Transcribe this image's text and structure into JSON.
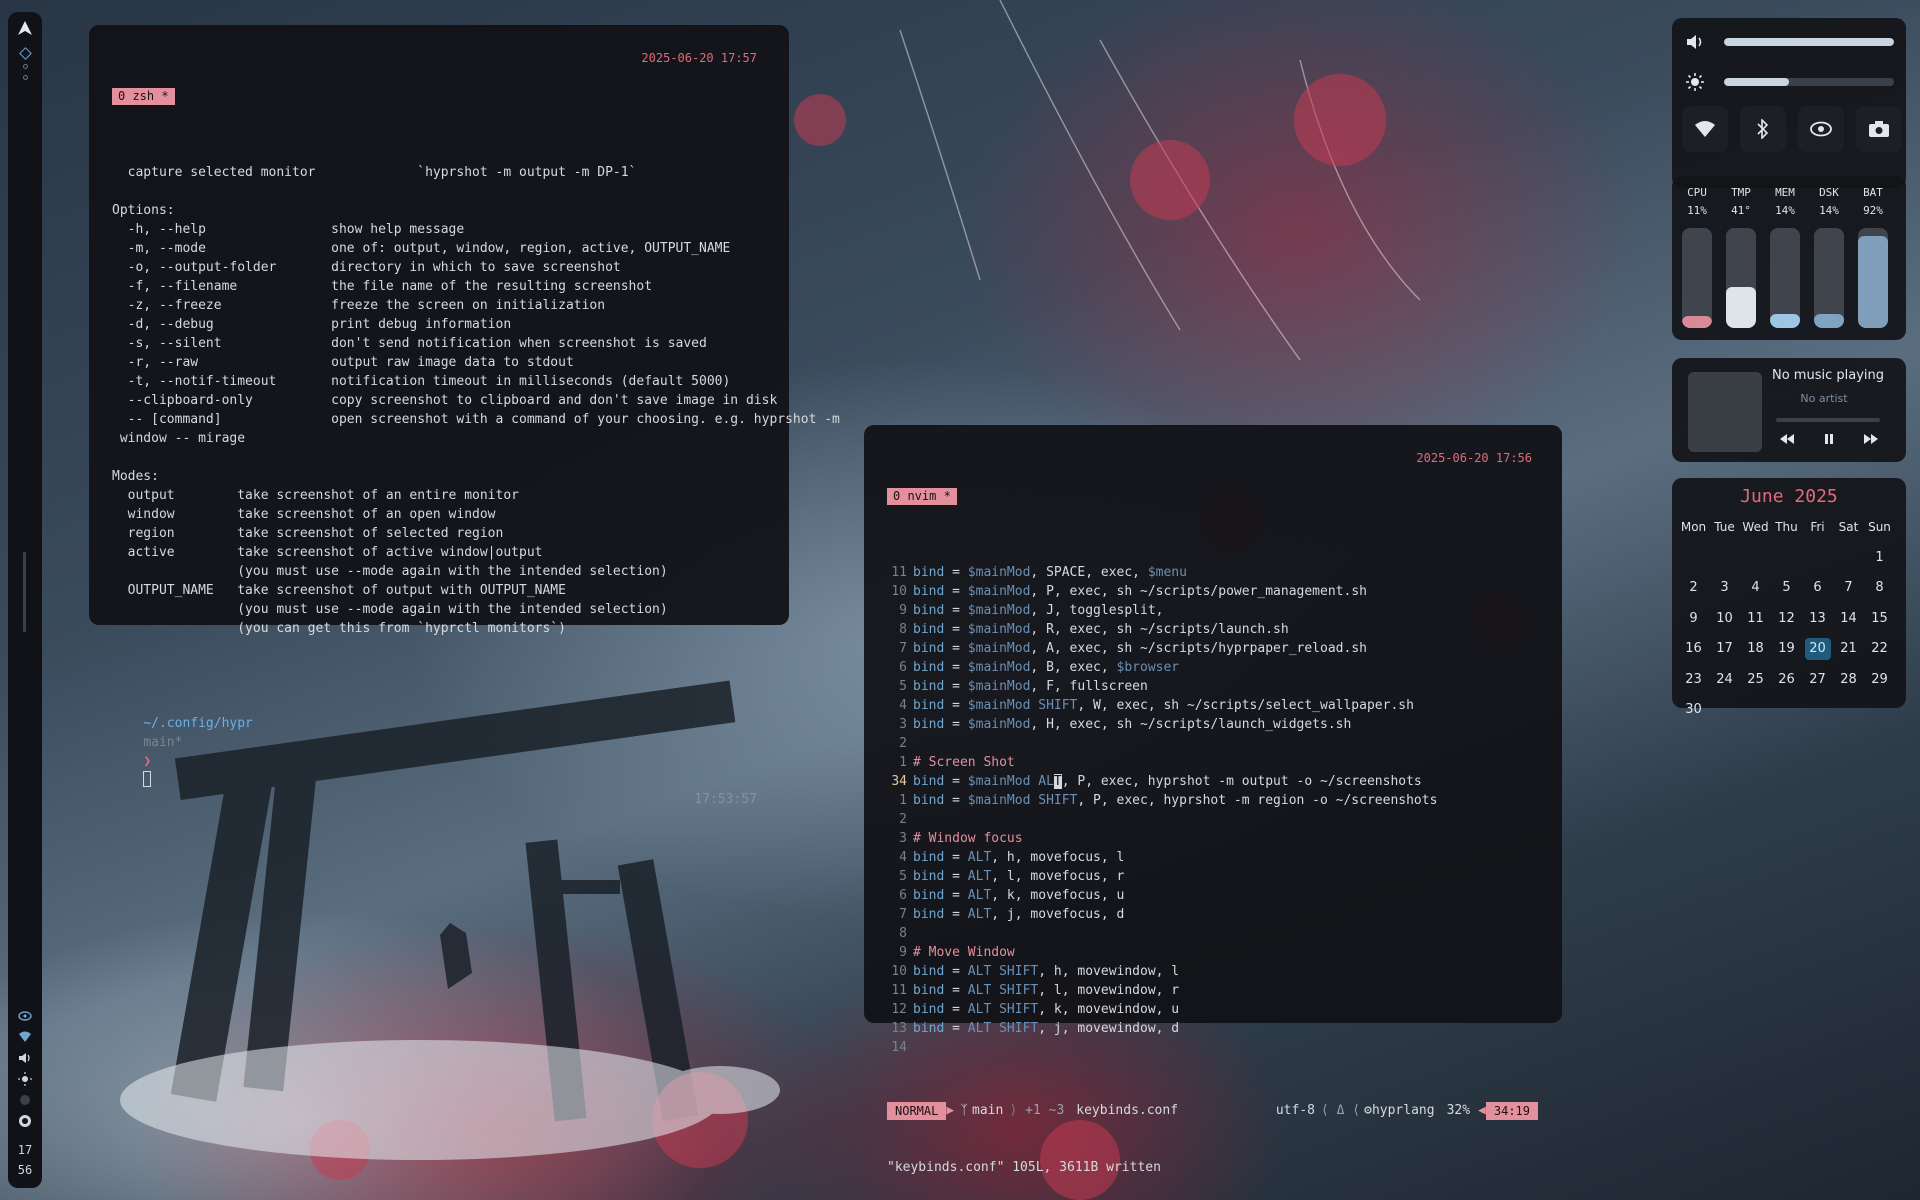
{
  "sidebar": {
    "logo": "arch-logo",
    "clock_hour": "17",
    "clock_min": "56"
  },
  "term1": {
    "tab": "0 zsh *",
    "timestamp": "2025-06-20 17:57",
    "lines": [
      "  capture selected monitor             `hyprshot -m output -m DP-1`",
      "",
      "Options:",
      "  -h, --help                show help message",
      "  -m, --mode                one of: output, window, region, active, OUTPUT_NAME",
      "  -o, --output-folder       directory in which to save screenshot",
      "  -f, --filename            the file name of the resulting screenshot",
      "  -z, --freeze              freeze the screen on initialization",
      "  -d, --debug               print debug information",
      "  -s, --silent              don't send notification when screenshot is saved",
      "  -r, --raw                 output raw image data to stdout",
      "  -t, --notif-timeout       notification timeout in milliseconds (default 5000)",
      "  --clipboard-only          copy screenshot to clipboard and don't save image in disk",
      "  -- [command]              open screenshot with a command of your choosing. e.g. hyprshot -m",
      " window -- mirage",
      "",
      "Modes:",
      "  output        take screenshot of an entire monitor",
      "  window        take screenshot of an open window",
      "  region        take screenshot of selected region",
      "  active        take screenshot of active window|output",
      "                (you must use --mode again with the intended selection)",
      "  OUTPUT_NAME   take screenshot of output with OUTPUT_NAME",
      "                (you must use --mode again with the intended selection)",
      "                (you can get this from `hyprctl monitors`)",
      ""
    ],
    "prompt_path": "~/.config/hypr",
    "prompt_branch": "main*",
    "prompt_arrow": "❯",
    "prompt_time": "17:53:57"
  },
  "term2": {
    "tab": "0 nvim *",
    "timestamp": "2025-06-20 17:56",
    "code": [
      {
        "n": "11",
        "k": "bind",
        "rest": " = ",
        "v": "$mainMod",
        "tail": ", SPACE, exec, ",
        "v2": "$menu"
      },
      {
        "n": "10",
        "k": "bind",
        "rest": " = ",
        "v": "$mainMod",
        "tail": ", P, exec, sh ~/scripts/power_management.sh"
      },
      {
        "n": "9",
        "k": "bind",
        "rest": " = ",
        "v": "$mainMod",
        "tail": ", J, togglesplit,"
      },
      {
        "n": "8",
        "k": "bind",
        "rest": " = ",
        "v": "$mainMod",
        "tail": ", R, exec, sh ~/scripts/launch.sh"
      },
      {
        "n": "7",
        "k": "bind",
        "rest": " = ",
        "v": "$mainMod",
        "tail": ", A, exec, sh ~/scripts/hyprpaper_reload.sh"
      },
      {
        "n": "6",
        "k": "bind",
        "rest": " = ",
        "v": "$mainMod",
        "tail": ", B, exec, ",
        "v2": "$browser"
      },
      {
        "n": "5",
        "k": "bind",
        "rest": " = ",
        "v": "$mainMod",
        "tail": ", F, fullscreen"
      },
      {
        "n": "4",
        "k": "bind",
        "rest": " = ",
        "v": "$mainMod SHIFT",
        "tail": ", W, exec, sh ~/scripts/select_wallpaper.sh"
      },
      {
        "n": "3",
        "k": "bind",
        "rest": " = ",
        "v": "$mainMod",
        "tail": ", H, exec, sh ~/scripts/launch_widgets.sh"
      },
      {
        "n": "2"
      },
      {
        "n": "1",
        "c": "# Screen Shot"
      },
      {
        "n": "34",
        "cur": true,
        "k": "bind",
        "rest": " = ",
        "v": "$mainMod AL",
        "curch": "T",
        "tail": ", P, exec, hyprshot -m output -o ~/screenshots"
      },
      {
        "n": "1",
        "k": "bind",
        "rest": " = ",
        "v": "$mainMod SHIFT",
        "tail": ", P, exec, hyprshot -m region -o ~/screenshots"
      },
      {
        "n": "2"
      },
      {
        "n": "3",
        "c": "# Window focus"
      },
      {
        "n": "4",
        "k": "bind",
        "rest": " = ",
        "v": "ALT",
        "tail": ", h, movefocus, l"
      },
      {
        "n": "5",
        "k": "bind",
        "rest": " = ",
        "v": "ALT",
        "tail": ", l, movefocus, r"
      },
      {
        "n": "6",
        "k": "bind",
        "rest": " = ",
        "v": "ALT",
        "tail": ", k, movefocus, u"
      },
      {
        "n": "7",
        "k": "bind",
        "rest": " = ",
        "v": "ALT",
        "tail": ", j, movefocus, d"
      },
      {
        "n": "8"
      },
      {
        "n": "9",
        "c": "# Move Window"
      },
      {
        "n": "10",
        "k": "bind",
        "rest": " = ",
        "v": "ALT SHIFT",
        "tail": ", h, movewindow, l"
      },
      {
        "n": "11",
        "k": "bind",
        "rest": " = ",
        "v": "ALT SHIFT",
        "tail": ", l, movewindow, r"
      },
      {
        "n": "12",
        "k": "bind",
        "rest": " = ",
        "v": "ALT SHIFT",
        "tail": ", k, movewindow, u"
      },
      {
        "n": "13",
        "k": "bind",
        "rest": " = ",
        "v": "ALT SHIFT",
        "tail": ", j, movewindow, d"
      },
      {
        "n": "14"
      }
    ],
    "status": {
      "mode": "NORMAL",
      "branch": "main",
      "diff": "+1 ~3",
      "file": "keybinds.conf",
      "encoding": "utf-8",
      "filetype": "hyprlang",
      "percent": "32%",
      "position": "34:19"
    },
    "message": "\"keybinds.conf\" 105L, 3611B written"
  },
  "controls": {
    "volume_level": 1.0,
    "brightness_level": 0.38,
    "toggles": [
      "wifi-icon",
      "bluetooth-icon",
      "eye-icon",
      "camera-icon"
    ]
  },
  "stats": [
    {
      "label": "CPU",
      "value": "11%",
      "level": 0.11,
      "color": "#d98a97"
    },
    {
      "label": "TMP",
      "value": "41°",
      "level": 0.41,
      "color": "#dfe4ea"
    },
    {
      "label": "MEM",
      "value": "14%",
      "level": 0.14,
      "color": "#9cc6e4"
    },
    {
      "label": "DSK",
      "value": "14%",
      "level": 0.14,
      "color": "#7fa3c0"
    },
    {
      "label": "BAT",
      "value": "92%",
      "level": 0.92,
      "color": "#7f9fbd"
    }
  ],
  "music": {
    "title": "No music playing",
    "artist": "No artist"
  },
  "calendar": {
    "title": "June 2025",
    "weekdays": [
      "Mon",
      "Tue",
      "Wed",
      "Thu",
      "Fri",
      "Sat",
      "Sun"
    ],
    "leading_blanks": 6,
    "days": [
      "1",
      "2",
      "3",
      "4",
      "5",
      "6",
      "7",
      "8",
      "9",
      "10",
      "11",
      "12",
      "13",
      "14",
      "15",
      "16",
      "17",
      "18",
      "19",
      "20",
      "21",
      "22",
      "23",
      "24",
      "25",
      "26",
      "27",
      "28",
      "29",
      "30"
    ],
    "today": "20"
  }
}
